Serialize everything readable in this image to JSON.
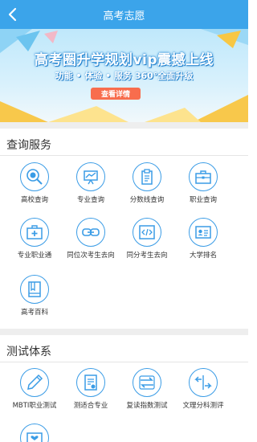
{
  "header": {
    "title": "高考志愿",
    "back_icon": "chevron-left-icon"
  },
  "banner": {
    "headline": "高考圈升学规划vip震撼上线",
    "subline": "功能 • 体验 • 服务  360°全面升级",
    "cta": "查看详情"
  },
  "sections": [
    {
      "title": "查询服务",
      "items": [
        {
          "label": "高校查询",
          "icon": "magnifier-icon"
        },
        {
          "label": "专业查询",
          "icon": "presentation-board-icon"
        },
        {
          "label": "分数线查询",
          "icon": "clipboard-icon"
        },
        {
          "label": "职业查询",
          "icon": "briefcase-icon"
        },
        {
          "label": "专业职业通",
          "icon": "medical-kit-icon"
        },
        {
          "label": "同位次考生去向",
          "icon": "link-icon"
        },
        {
          "label": "同分考生去向",
          "icon": "code-window-icon"
        },
        {
          "label": "大学排名",
          "icon": "id-card-icon"
        },
        {
          "label": "高考百科",
          "icon": "book-icon"
        }
      ]
    },
    {
      "title": "测试体系",
      "items": [
        {
          "label": "MBTI职业测试",
          "icon": "pen-icon"
        },
        {
          "label": "测适合专业",
          "icon": "checklist-icon"
        },
        {
          "label": "复读指数测试",
          "icon": "cycle-arrows-icon"
        },
        {
          "label": "文理分科测评",
          "icon": "split-arrows-icon"
        },
        {
          "label": "",
          "icon": "heart-board-icon"
        }
      ]
    }
  ],
  "colors": {
    "accent": "#3ba4ea",
    "icon_stroke": "#3a9ce6",
    "cta": "#f86d4d",
    "section_gap": "#eeeeee"
  }
}
